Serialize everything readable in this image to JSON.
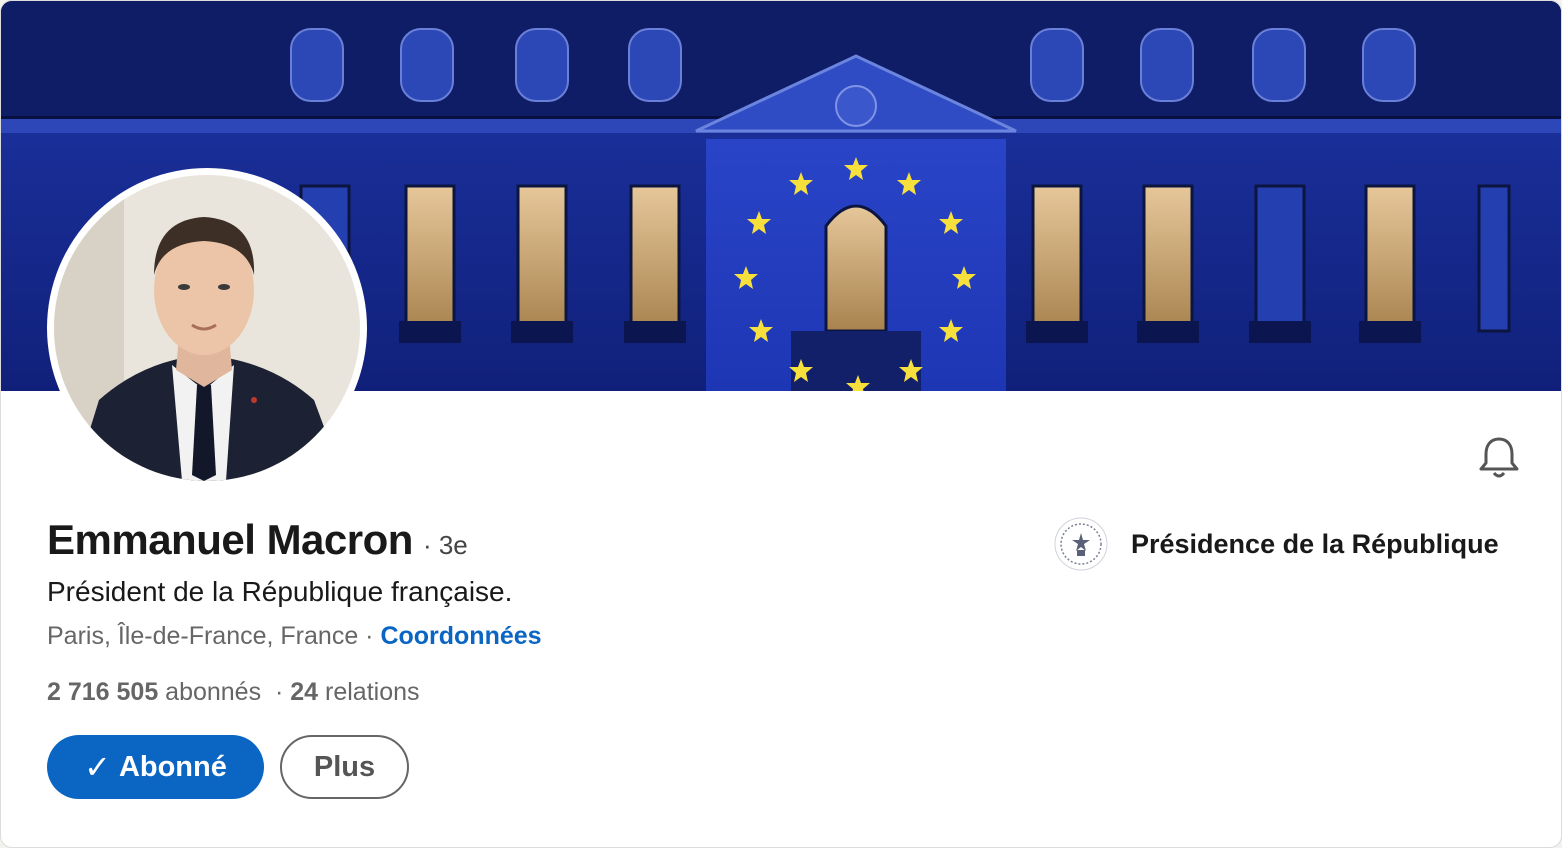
{
  "profile": {
    "name": "Emmanuel Macron",
    "degree": "· 3e",
    "headline": "Président de la République française.",
    "location": "Paris, Île-de-France, France",
    "location_sep": " · ",
    "contact_link": "Coordonnées",
    "followers_count": "2 716 505",
    "followers_label": " abonnés",
    "stats_sep": "  · ",
    "relations_count": "24",
    "relations_label": " relations"
  },
  "actions": {
    "follow_check": "✓",
    "follow_label": "Abonné",
    "more_label": "Plus"
  },
  "organization": {
    "name": "Présidence de la République"
  },
  "colors": {
    "accent": "#0a66c2",
    "cover_blue": "#1b34a8",
    "eu_star": "#f7e03c"
  },
  "icons": {
    "bell": "bell-icon",
    "check": "check-icon",
    "org_logo": "presidence-seal-icon"
  }
}
